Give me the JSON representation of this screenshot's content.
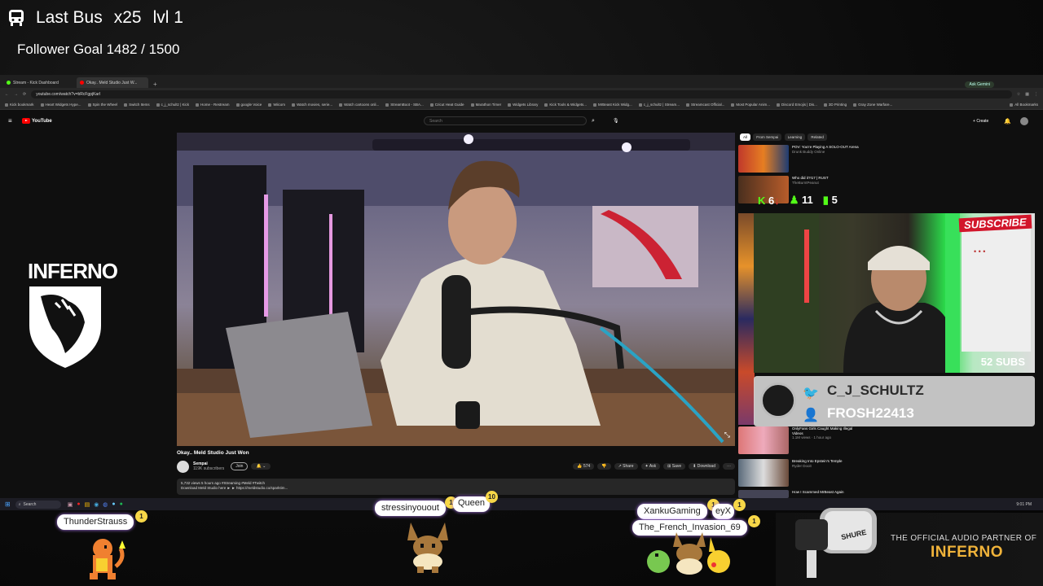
{
  "overlay": {
    "bus_label": "Last Bus",
    "multiplier": "x25",
    "level": "lvl 1",
    "follower_goal": "Follower Goal 1482 / 1500"
  },
  "browser": {
    "tabs": [
      {
        "label": "Stream - Kick Dashboard"
      },
      {
        "label": "Okay.. Meld Studio Just W..."
      }
    ],
    "url": "youtube.com/watch?v=bRcFgpjKarI",
    "gemini": "Ask Gemini",
    "bookmarks": [
      "Kick bookmark",
      "Heart Widgets Hype...",
      "Spin the Wheel",
      "Switch Items",
      "c_j_schultz | Kick",
      "Home - Restream",
      "google Voice",
      "Wiicom",
      "Watch movies, serie...",
      "Watch cartoons onli...",
      "StreamBoot - SBA...",
      "Cricut Heat Guide",
      "Marathon Timer",
      "Widgets Library",
      "Kick Tools & Widgets...",
      "MrBeast Kick Widg...",
      "c_j_schultz | Stream...",
      "Streamcast Official...",
      "Most Popular Anim...",
      "Discord Emojis | Dis...",
      "3D Printing",
      "Gray Zone Warfare...",
      "All Bookmarks"
    ]
  },
  "youtube": {
    "brand": "YouTube",
    "search_placeholder": "Search",
    "create": "Create",
    "video_title": "Okay.. Meld Studio Just Won",
    "channel_name": "Sempai",
    "subscribers": "119K subscribers",
    "join": "Join",
    "likes": "574",
    "share": "Share",
    "ask": "Ask",
    "save": "Save",
    "download": "Download",
    "desc_line1": "5,732 views  5 hours ago  #Streaming #Meld #Twitch",
    "desc_line2": "Download Meld Studio here ► ► https://meldstudio.co/sparktim...",
    "chips": [
      "All",
      "From Sempai",
      "Learning",
      "Related"
    ],
    "recs": [
      {
        "title": "POV: You're Playing A SOLO-OUT Arena",
        "meta": "Drunk Buddy Online"
      },
      {
        "title": "Who did it?!17 | RUST",
        "meta": "TheBurntPeanut"
      },
      {
        "title": "OnlyFans Girls Caught Making Illegal Videos",
        "meta": "1.1M views · 1 hour ago"
      },
      {
        "title": "Breaking Into Epstein's Temple",
        "meta": "Ryder Dooit"
      },
      {
        "title": "How I Scammed MrBeast Again",
        "meta": ""
      }
    ]
  },
  "taskbar": {
    "search": "Search",
    "clock": "9:01 PM"
  },
  "cam": {
    "stat1": "6",
    "stat2": "11",
    "stat3": "5",
    "subs": "52 SUBS",
    "subscribe": "SUBSCRIBE",
    "twitter": "C_J_SCHULTZ",
    "tiktok": "FROSH22413"
  },
  "chatters": [
    {
      "name": "ThunderStrauss",
      "badge": "1"
    },
    {
      "name": "stressinyouout",
      "badge": "1"
    },
    {
      "name": "Queen",
      "badge": "10"
    },
    {
      "name": "XankuGaming",
      "badge": "1"
    },
    {
      "name": "eyX",
      "badge": "1"
    },
    {
      "name": "The_French_Invasion_69",
      "badge": "1"
    }
  ],
  "sponsor": {
    "line1": "THE OFFICIAL AUDIO PARTNER OF",
    "line2": "INFERNO",
    "mic_brand": "SHURE"
  },
  "logo": {
    "text": "INFERNO"
  }
}
